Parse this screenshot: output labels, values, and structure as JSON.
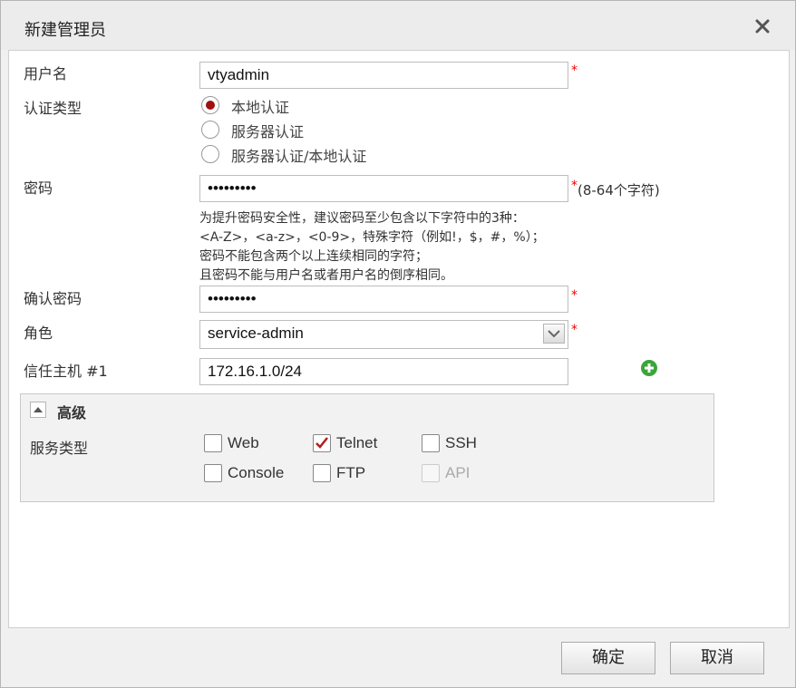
{
  "dialog": {
    "title": "新建管理员"
  },
  "form": {
    "username": {
      "label": "用户名",
      "value": "vtyadmin"
    },
    "auth_type": {
      "label": "认证类型",
      "options": [
        "本地认证",
        "服务器认证",
        "服务器认证/本地认证"
      ],
      "selected": "本地认证"
    },
    "password": {
      "label": "密码",
      "value": "•••••••••",
      "length_hint": "(8-64个字符)",
      "hint_lines": [
        "为提升密码安全性，建议密码至少包含以下字符中的3种：",
        "<A-Z>，<a-z>，<0-9>，特殊字符（例如!，$，#，%）；",
        "密码不能包含两个以上连续相同的字符；",
        "且密码不能与用户名或者用户名的倒序相同。"
      ]
    },
    "confirm_password": {
      "label": "确认密码",
      "value": "•••••••••"
    },
    "role": {
      "label": "角色",
      "value": "service-admin"
    },
    "trusted_host": {
      "label": "信任主机 #1",
      "value": "172.16.1.0/24"
    },
    "required_mark": "*"
  },
  "advanced": {
    "title": "高级",
    "service_label": "服务类型",
    "services": [
      {
        "name": "Web",
        "checked": false,
        "disabled": false
      },
      {
        "name": "Telnet",
        "checked": true,
        "disabled": false
      },
      {
        "name": "SSH",
        "checked": false,
        "disabled": false
      },
      {
        "name": "Console",
        "checked": false,
        "disabled": false
      },
      {
        "name": "FTP",
        "checked": false,
        "disabled": false
      },
      {
        "name": "API",
        "checked": false,
        "disabled": true
      }
    ]
  },
  "footer": {
    "ok_label": "确定",
    "cancel_label": "取消"
  },
  "colors": {
    "accent_radio": "#a01010",
    "check": "#b11d1d",
    "add_icon": "#3aa53a",
    "required": "#e00000"
  }
}
